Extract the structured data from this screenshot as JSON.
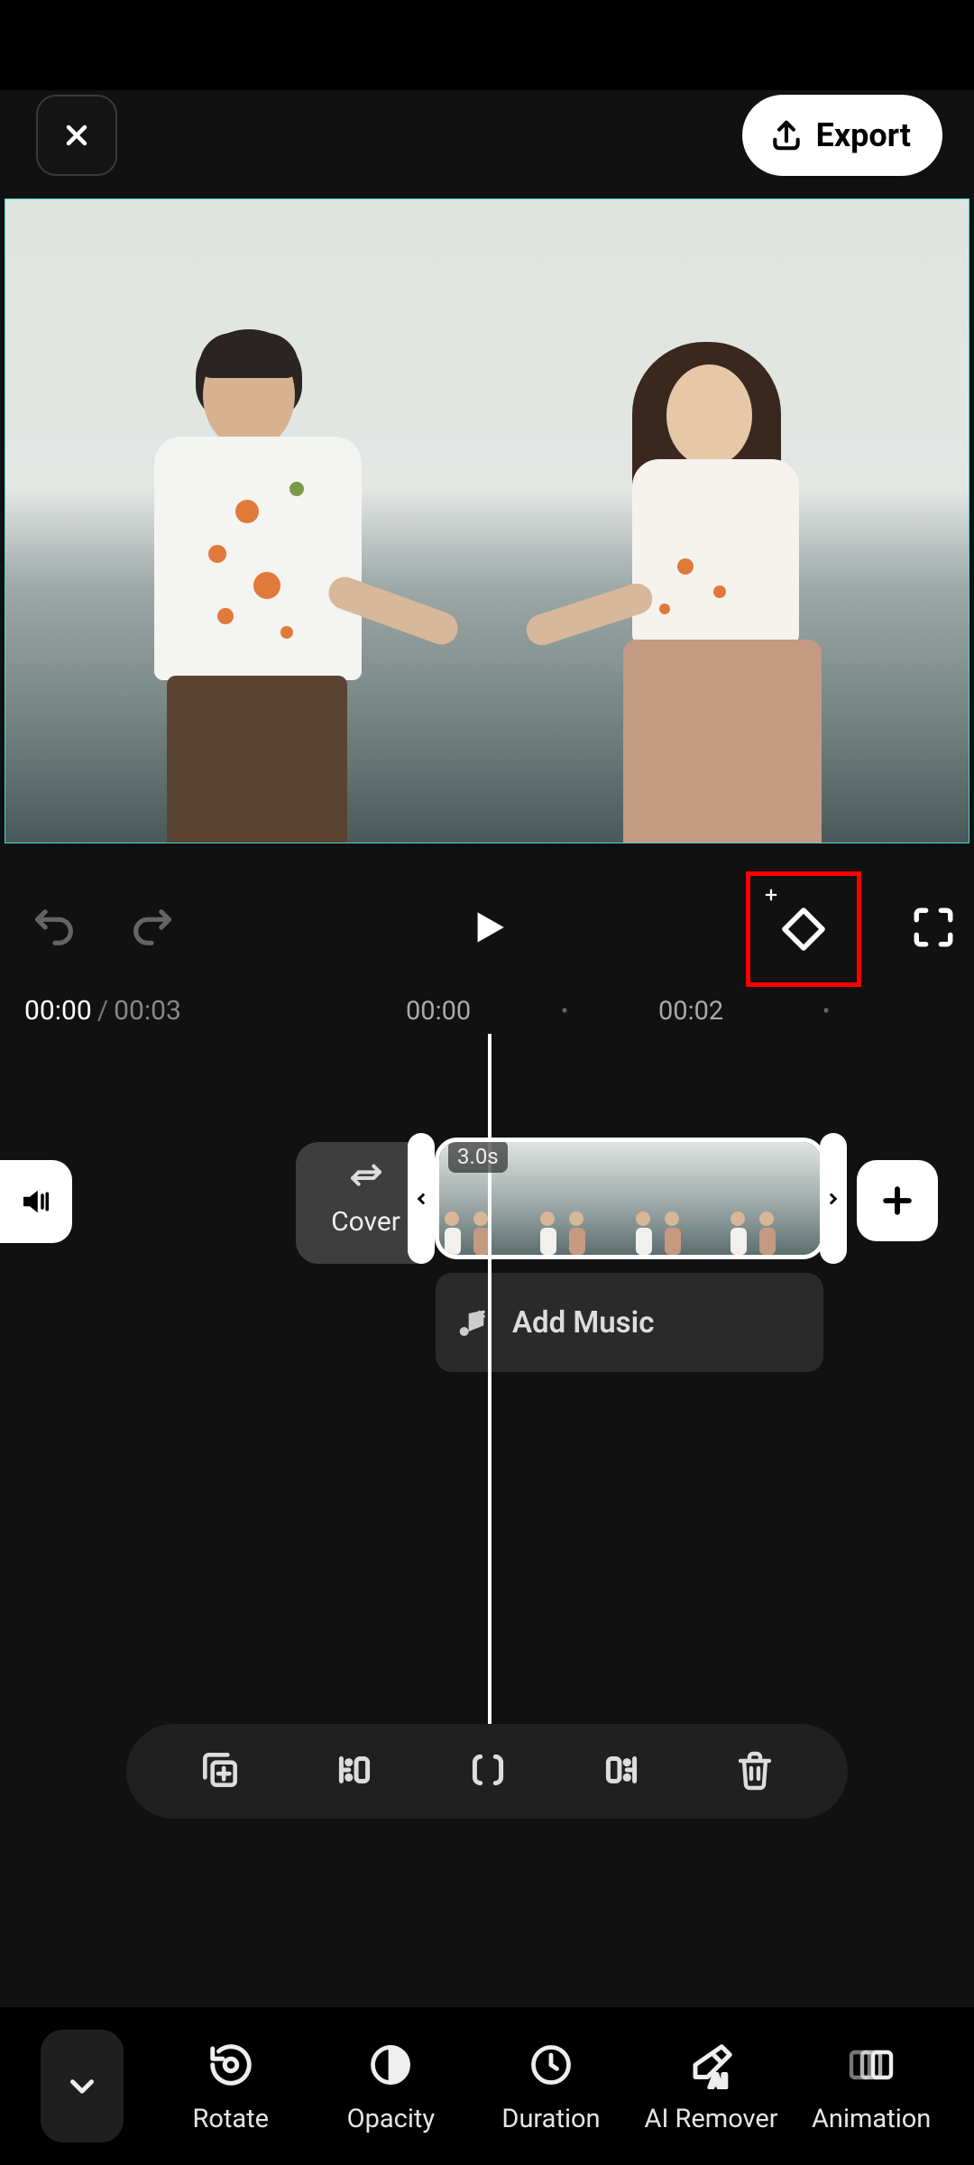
{
  "header": {
    "export_label": "Export"
  },
  "playback": {
    "current": "00:00",
    "total": "00:03",
    "ruler": {
      "tick1": "00:00",
      "tick2": "00:02"
    }
  },
  "timeline": {
    "cover_label": "Cover",
    "clip_duration": "3.0s",
    "add_music_label": "Add Music"
  },
  "tools": {
    "rotate": "Rotate",
    "opacity": "Opacity",
    "duration": "Duration",
    "ai_remover": "AI Remover",
    "animation": "Animation"
  }
}
